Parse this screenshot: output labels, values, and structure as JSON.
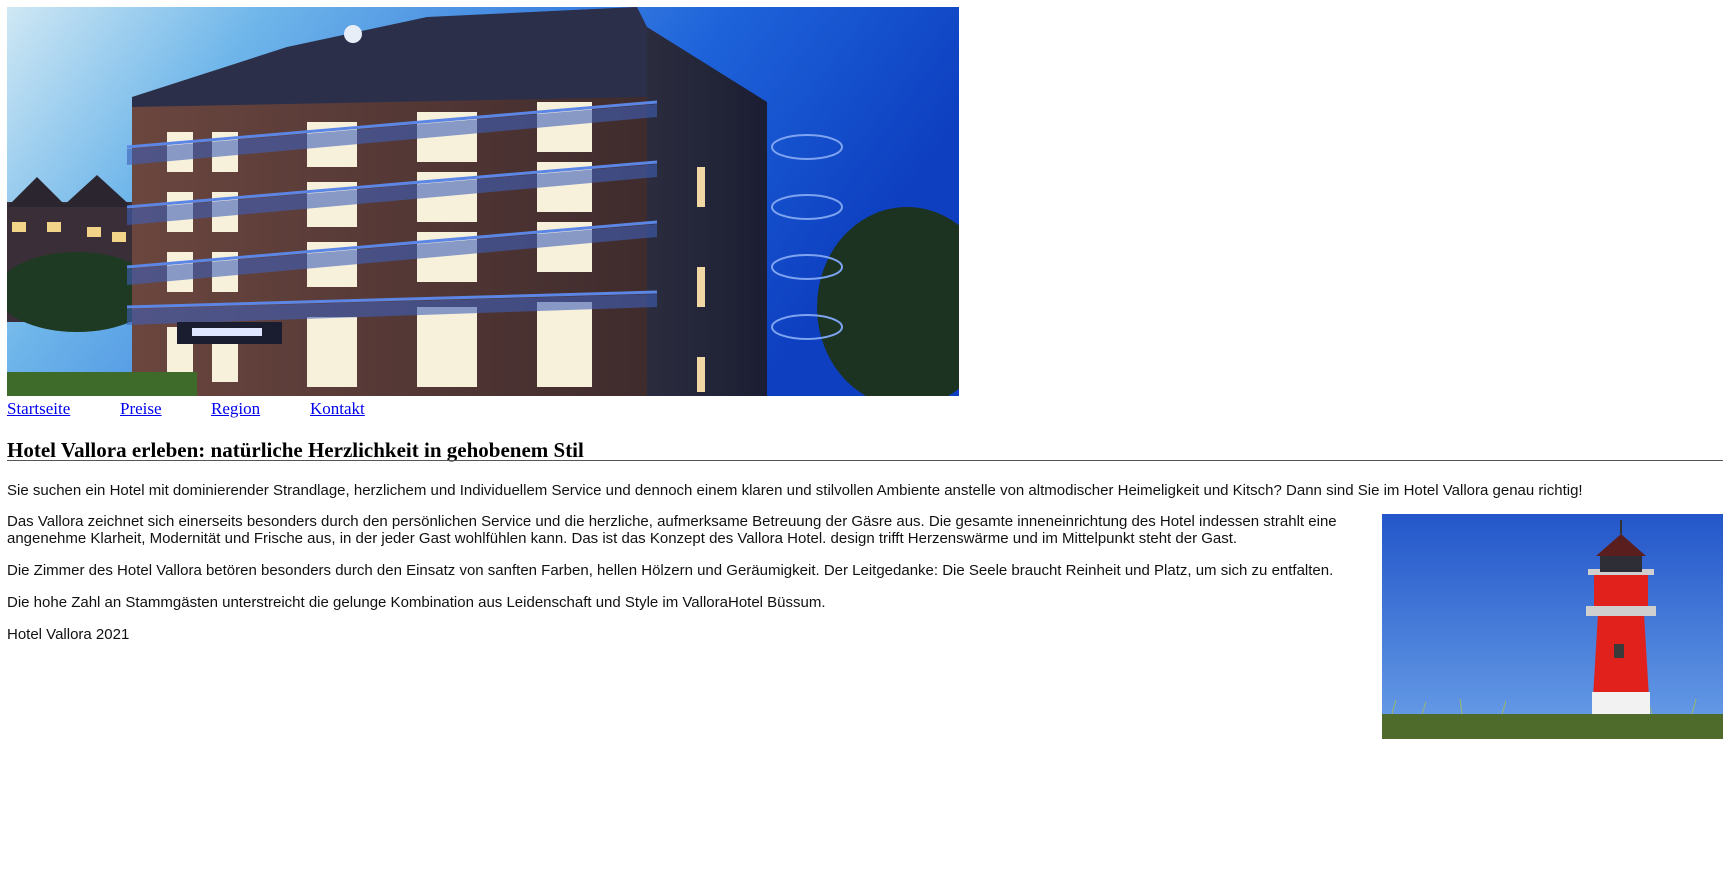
{
  "nav": {
    "items": [
      {
        "label": "Startseite "
      },
      {
        "label": "Preise "
      },
      {
        "label": "Region "
      },
      {
        "label": "Kontakt"
      }
    ]
  },
  "heading": "Hotel Vallora erleben: natürliche Herzlichkeit in gehobenem Stil",
  "paragraphs": {
    "intro": "Sie suchen ein Hotel mit dominierender Strandlage, herzlichem und Individuellem Service und dennoch einem klaren und stilvollen Ambiente anstelle von altmodischer Heimeligkeit und Kitsch? Dann sind Sie im Hotel Vallora genau richtig!",
    "service": "Das Vallora zeichnet sich einerseits besonders durch den persönlichen Service und die herzliche, aufmerksame Betreuung der Gäsre aus. Die gesamte inneneinrichtung des Hotel indessen strahlt eine angenehme Klarheit, Modernität und Frische aus, in der jeder Gast wohlfühlen kann. Das ist das Konzept des Vallora Hotel. design trifft Herzenswärme und im Mittelpunkt steht der Gast.",
    "zimmer": "Die Zimmer des Hotel Vallora betören besonders durch den Einsatz von sanften Farben, hellen Hölzern und Geräumigkeit. Der Leitgedanke: Die Seele braucht Reinheit und Platz, um sich zu entfalten.",
    "zahl": "Die hohe Zahl an Stammgästen unterstreicht die gelunge Kombination aus Leidenschaft und Style im ValloraHotel Büssum.",
    "copyright": "Hotel Vallora 2021"
  },
  "colors": {
    "link": "#0000ee",
    "sky_top": "#1f5fd6",
    "brick": "#5a3a36",
    "lighthouse_red": "#e0211c"
  }
}
